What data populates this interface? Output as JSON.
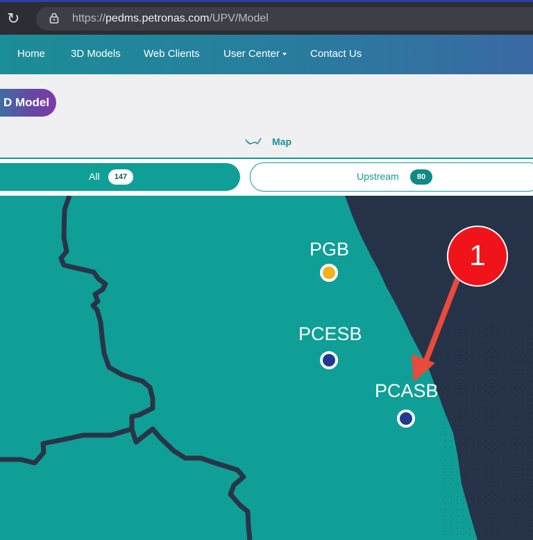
{
  "browser": {
    "url_prefix": "https://",
    "url_host": "pedms.petronas.com",
    "url_path": "/UPV/Model"
  },
  "nav": {
    "items": [
      {
        "label": "Home"
      },
      {
        "label": "3D Models"
      },
      {
        "label": "Web Clients"
      },
      {
        "label": "User Center"
      },
      {
        "label": "Contact Us"
      }
    ]
  },
  "page": {
    "model_button": "D Model",
    "map_tab": "Map"
  },
  "filters": {
    "all_label": "All",
    "all_count": "147",
    "upstream_label": "Upstream",
    "upstream_count": "80"
  },
  "map": {
    "sites": [
      {
        "label": "PGB",
        "status_color": "#f3b21c"
      },
      {
        "label": "PCESB",
        "status_color": "#1f3a8f"
      },
      {
        "label": "PCASB",
        "status_color": "#1f3a8f"
      }
    ],
    "land_color": "#0f9f97",
    "sea_color": "#263247"
  },
  "annotation": {
    "number": "1",
    "color": "#f0141a"
  }
}
